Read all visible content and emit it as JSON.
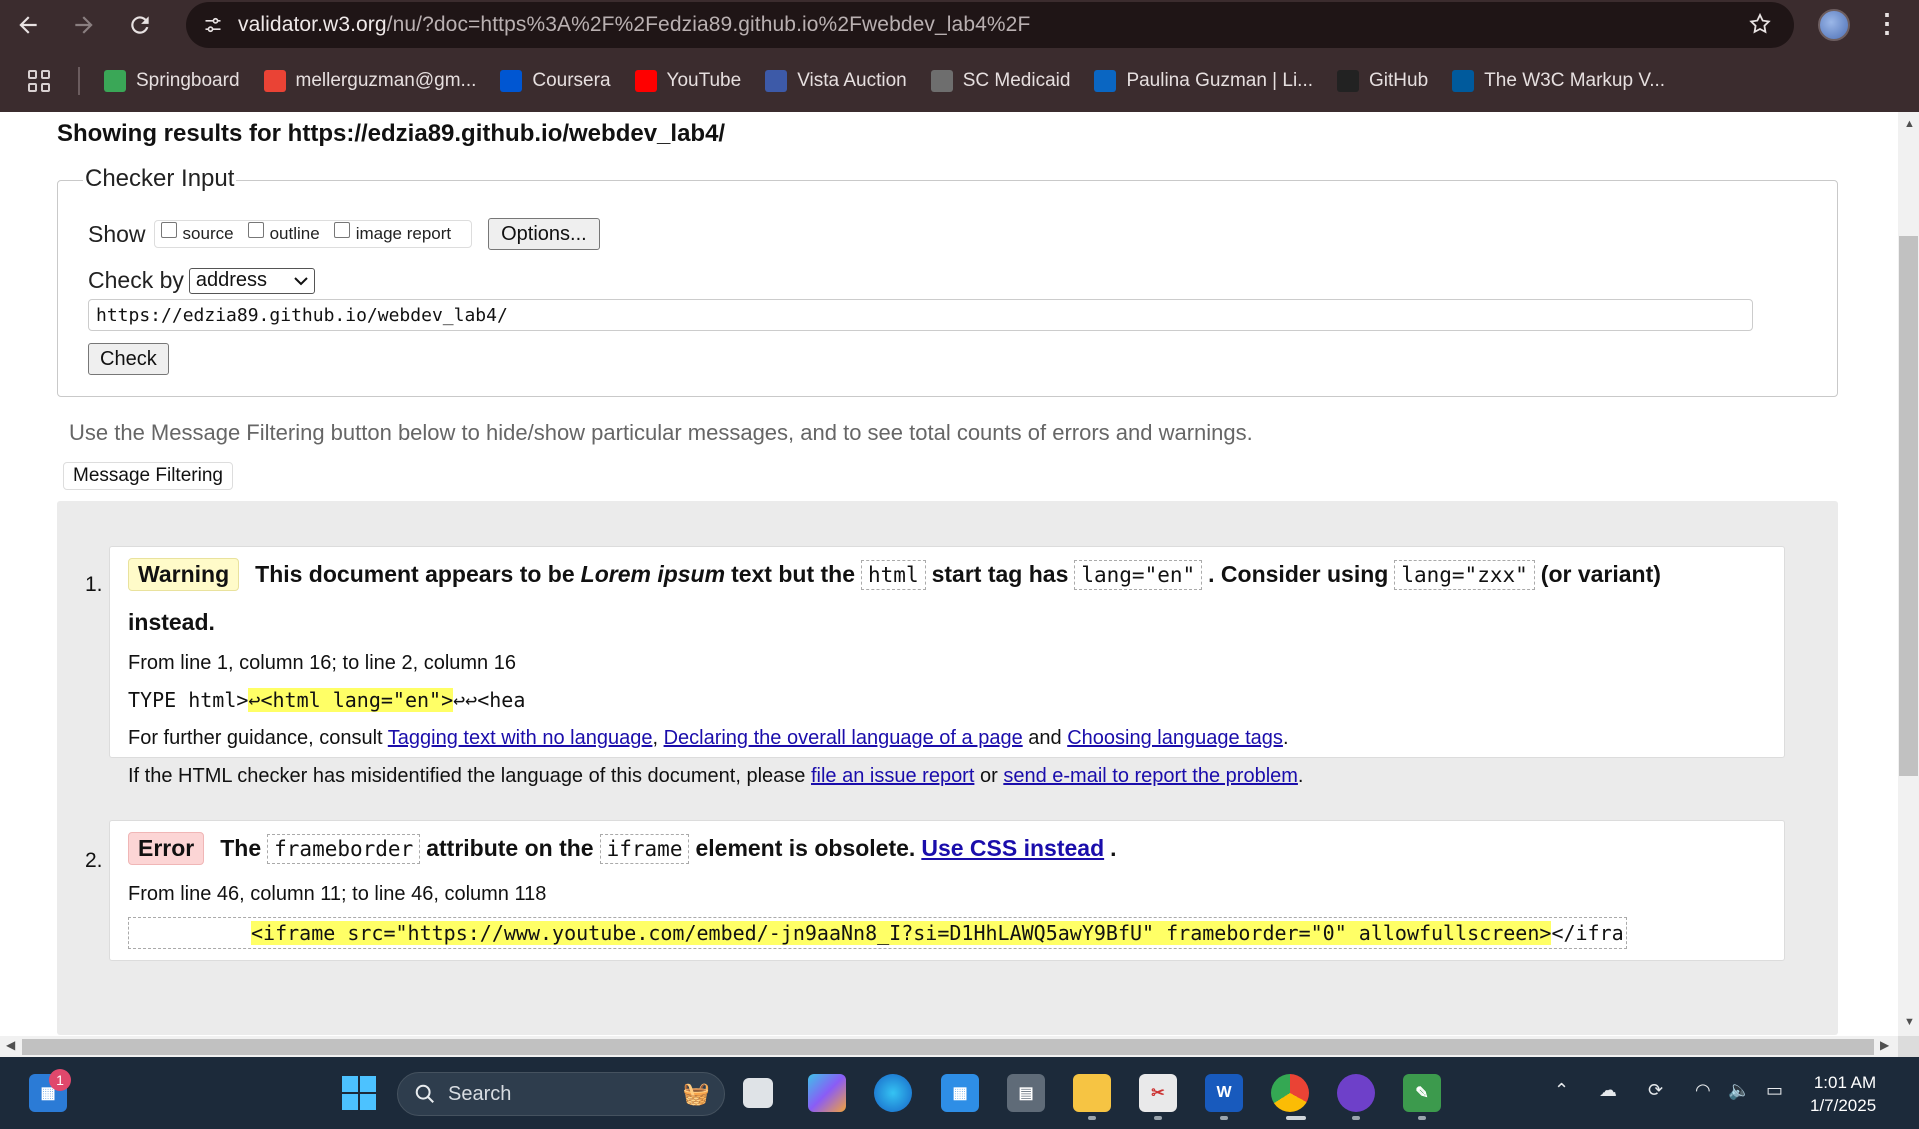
{
  "browser": {
    "url_host": "validator.w3.org",
    "url_path": "/nu/?doc=https%3A%2F%2Fedzia89.github.io%2Fwebdev_lab4%2F",
    "bookmarks": [
      {
        "label": "Springboard",
        "icon": "springboard-icon",
        "color": "#3aa757"
      },
      {
        "label": "mellerguzman@gm...",
        "icon": "gmail-icon",
        "color": "#ea4335"
      },
      {
        "label": "Coursera",
        "icon": "coursera-icon",
        "color": "#0056d2"
      },
      {
        "label": "YouTube",
        "icon": "youtube-icon",
        "color": "#ff0000"
      },
      {
        "label": "Vista Auction",
        "icon": "vista-auction-icon",
        "color": "#3d5aa8"
      },
      {
        "label": "SC Medicaid",
        "icon": "globe-icon",
        "color": "#6e6e6e"
      },
      {
        "label": "Paulina Guzman | Li...",
        "icon": "linkedin-icon",
        "color": "#0a66c2"
      },
      {
        "label": "GitHub",
        "icon": "github-icon",
        "color": "#222222"
      },
      {
        "label": "The W3C Markup V...",
        "icon": "w3c-icon",
        "color": "#005a9c"
      }
    ]
  },
  "page": {
    "results_heading": "Showing results for https://edzia89.github.io/webdev_lab4/",
    "checker_legend": "Checker Input",
    "show_label": "Show",
    "show_options": [
      "source",
      "outline",
      "image report"
    ],
    "options_button": "Options...",
    "check_by_label": "Check by",
    "check_by_value": "address",
    "address_value": "https://edzia89.github.io/webdev_lab4/",
    "check_button": "Check",
    "filter_note": "Use the Message Filtering button below to hide/show particular messages, and to see total counts of errors and warnings.",
    "filter_button": "Message Filtering"
  },
  "messages": [
    {
      "number": "1.",
      "type": "Warning",
      "text_a": "This document appears to be",
      "text_em": "Lorem ipsum",
      "text_b": "text but the",
      "code_1": "html",
      "text_c": "start tag has",
      "code_2": "lang=\"en\"",
      "text_d": ". Consider using",
      "code_3": "lang=\"zxx\"",
      "text_e": "(or variant)",
      "text_f": "instead.",
      "location": "From line 1, column 16; to line 2, column 16",
      "extract_pre": "TYPE html>",
      "extract_hl": "↩<html lang=\"en\">",
      "extract_post": "↩↩<hea",
      "guidance_prefix": "For further guidance, consult",
      "link_1": "Tagging text with no language",
      "link_2": "Declaring the overall language of a page",
      "and_text": "and",
      "link_3": "Choosing language tags",
      "misid_prefix": "If the HTML checker has misidentified the language of this document, please",
      "link_4": "file an issue report",
      "or_text": "or",
      "link_5": "send e-mail to report the problem"
    },
    {
      "number": "2.",
      "type": "Error",
      "text_a": "The",
      "code_1": "frameborder",
      "text_b": "attribute on the",
      "code_2": "iframe",
      "text_c": "element is obsolete.",
      "link": "Use CSS instead",
      "location": "From line 46, column 11; to line 46, column 118",
      "extract_hl": "<iframe src=\"https://www.youtube.com/embed/-jn9aaNn8_I?si=D1HhLAWQ5awY9BfU\" frameborder=\"0\" allowfullscreen>",
      "extract_post": "</ifra"
    }
  ],
  "taskbar": {
    "search_placeholder": "Search",
    "notification_count": "1",
    "time": "1:01 AM",
    "date": "1/7/2025"
  }
}
